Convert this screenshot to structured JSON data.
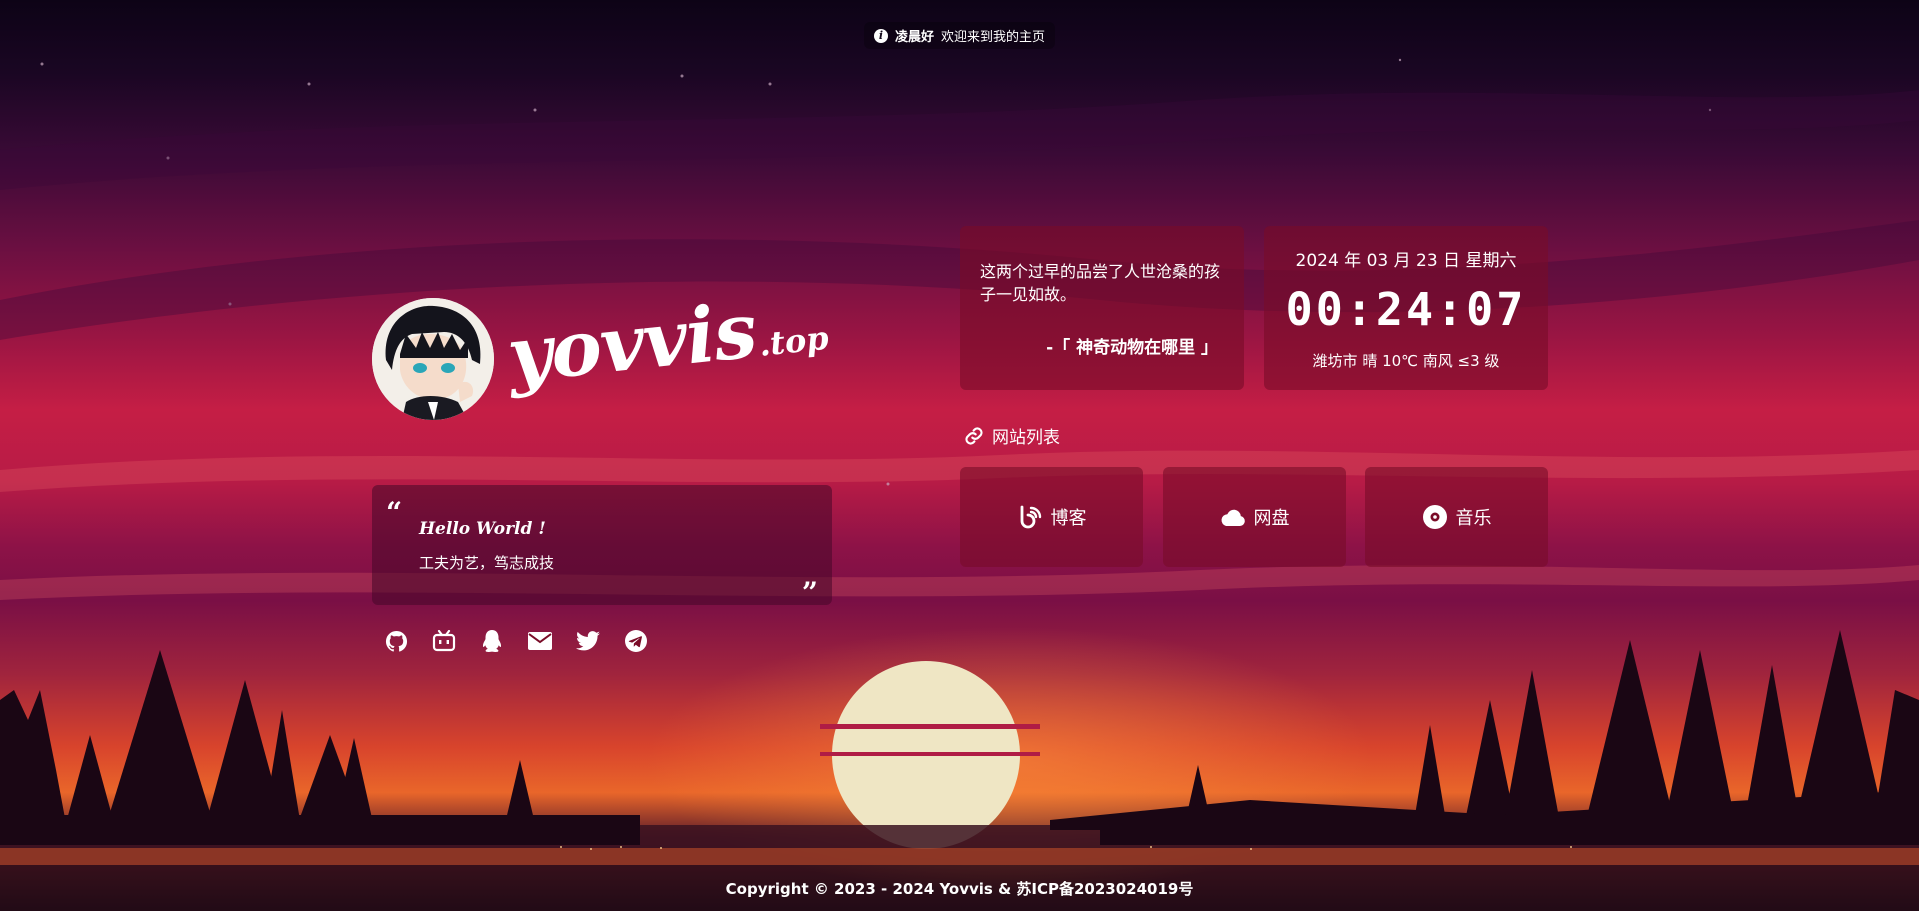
{
  "notice": {
    "greeting": "凌晨好",
    "message": "欢迎来到我的主页",
    "icon": "info-icon"
  },
  "brand": {
    "name": "yovvis",
    "suffix": ".top"
  },
  "hello": {
    "title": "Hello World !",
    "text": "工夫为艺，笃志成技"
  },
  "socials": [
    {
      "name": "github",
      "icon": "github-icon"
    },
    {
      "name": "bilibili",
      "icon": "bilibili-icon"
    },
    {
      "name": "qq",
      "icon": "qq-icon"
    },
    {
      "name": "email",
      "icon": "mail-icon"
    },
    {
      "name": "twitter",
      "icon": "twitter-icon"
    },
    {
      "name": "telegram",
      "icon": "telegram-icon"
    }
  ],
  "quote": {
    "text": "这两个过早的品尝了人世沧桑的孩子一见如故。",
    "source": "-「 神奇动物在哪里 」"
  },
  "time": {
    "date": "2024 年 03 月 23 日 星期六",
    "clock": "00:24:07",
    "weather": "潍坊市 晴 10℃  南风  ≤3 级"
  },
  "sites": {
    "header": "网站列表",
    "items": [
      {
        "label": "博客",
        "icon": "blog-icon"
      },
      {
        "label": "网盘",
        "icon": "cloud-icon"
      },
      {
        "label": "音乐",
        "icon": "music-disc-icon"
      }
    ]
  },
  "footer": {
    "text": "Copyright © 2023 - 2024 Yovvis & 苏ICP备2023024019号"
  },
  "colors": {
    "card": "#7a0c28",
    "sun": "#efe6c4",
    "sky_top": "#0d0316",
    "horizon": "#e9662a"
  }
}
